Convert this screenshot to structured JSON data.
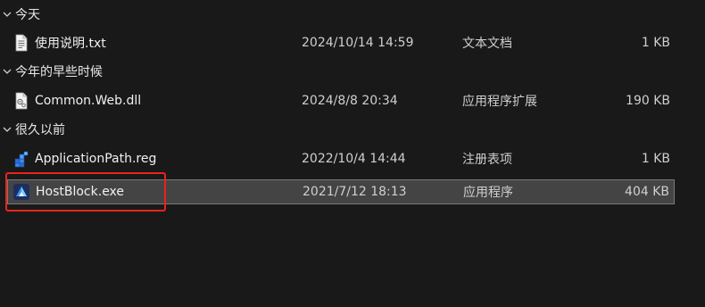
{
  "groups": [
    {
      "label": "今天",
      "files": [
        {
          "name": "使用说明.txt",
          "date": "2024/10/14 14:59",
          "type": "文本文档",
          "size": "1 KB",
          "icon": "text-file-icon"
        }
      ]
    },
    {
      "label": "今年的早些时候",
      "files": [
        {
          "name": "Common.Web.dll",
          "date": "2024/8/8 20:34",
          "type": "应用程序扩展",
          "size": "190 KB",
          "icon": "dll-file-icon"
        }
      ]
    },
    {
      "label": "很久以前",
      "files": [
        {
          "name": "ApplicationPath.reg",
          "date": "2022/10/4 14:44",
          "type": "注册表项",
          "size": "1 KB",
          "icon": "registry-file-icon"
        },
        {
          "name": "HostBlock.exe",
          "date": "2021/7/12 18:13",
          "type": "应用程序",
          "size": "404 KB",
          "icon": "exe-file-icon"
        }
      ]
    }
  ],
  "colors": {
    "background": "#191919",
    "selection": "#444444",
    "highlight_box": "#e8231c"
  }
}
